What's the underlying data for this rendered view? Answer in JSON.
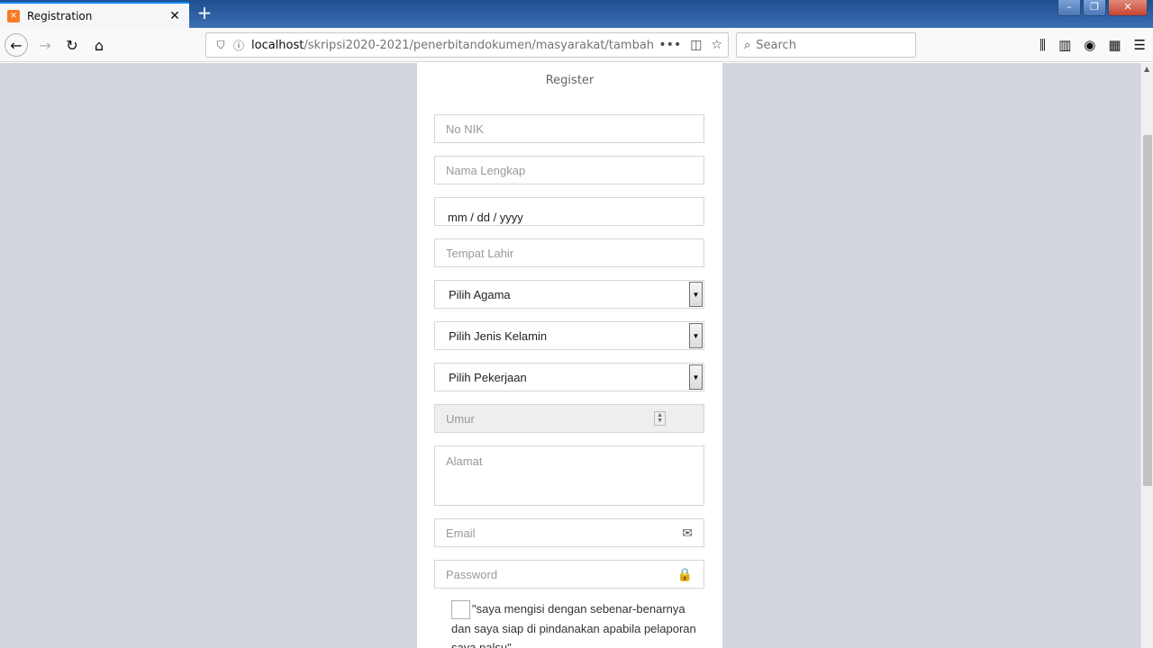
{
  "browser": {
    "tab_title": "Registration",
    "url_host": "localhost",
    "url_path": "/skripsi2020-2021/penerbitandokumen/masyarakat/tambah",
    "search_placeholder": "Search"
  },
  "form": {
    "title": "Register",
    "nik_placeholder": "No NIK",
    "nama_placeholder": "Nama Lengkap",
    "tanggal_lahir_value": "mm / dd / yyyy",
    "tempat_lahir_placeholder": "Tempat Lahir",
    "agama_selected": "Pilih Agama",
    "jenis_kelamin_selected": "Pilih Jenis Kelamin",
    "pekerjaan_selected": "Pilih Pekerjaan",
    "umur_placeholder": "Umur",
    "alamat_placeholder": "Alamat",
    "email_placeholder": "Email",
    "password_placeholder": "Password",
    "agreement_text": "\"saya mengisi dengan sebenar-benarnya dan saya siap di pindanakan apabila pelaporan saya palsu\""
  },
  "colors": {
    "page_bg": "#d2d6de",
    "card_bg": "#ffffff",
    "border": "#d2d6de"
  }
}
